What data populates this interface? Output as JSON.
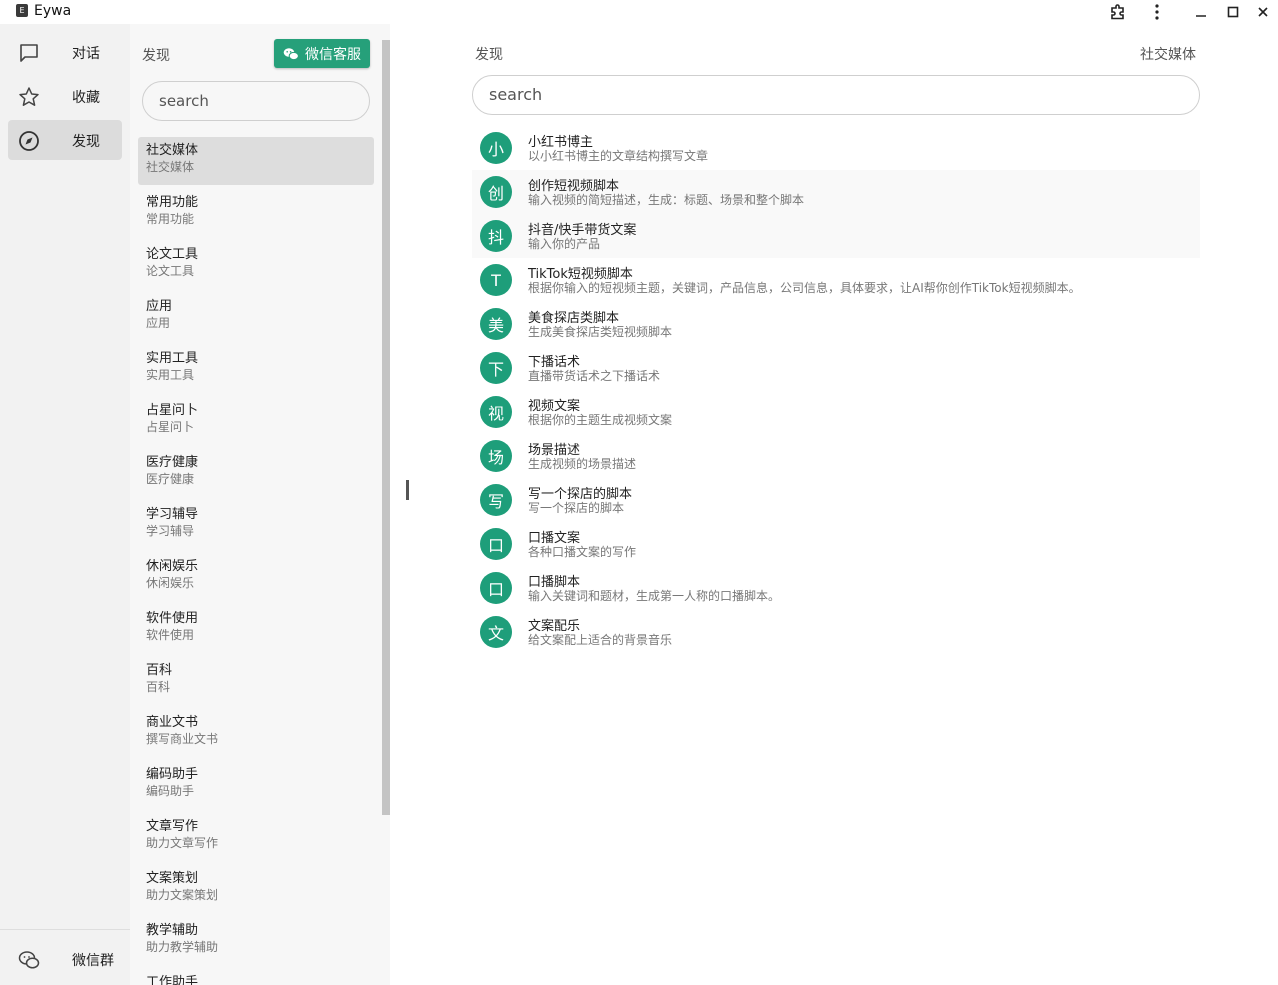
{
  "window": {
    "title": "Eywa",
    "icon_letter": "E"
  },
  "rail": {
    "items": [
      {
        "label": "对话",
        "icon": "chat-icon"
      },
      {
        "label": "收藏",
        "icon": "star-icon"
      },
      {
        "label": "发现",
        "icon": "compass-icon",
        "active": true
      }
    ],
    "bottom": {
      "label": "微信群",
      "icon": "wechat-icon"
    }
  },
  "categories": {
    "title": "发现",
    "wechat_button": "微信客服",
    "search_placeholder": "search",
    "items": [
      {
        "name": "社交媒体",
        "sub": "社交媒体",
        "active": true
      },
      {
        "name": "常用功能",
        "sub": "常用功能"
      },
      {
        "name": "论文工具",
        "sub": "论文工具"
      },
      {
        "name": "应用",
        "sub": "应用"
      },
      {
        "name": "实用工具",
        "sub": "实用工具"
      },
      {
        "name": "占星问卜",
        "sub": "占星问卜"
      },
      {
        "name": "医疗健康",
        "sub": "医疗健康"
      },
      {
        "name": "学习辅导",
        "sub": "学习辅导"
      },
      {
        "name": "休闲娱乐",
        "sub": "休闲娱乐"
      },
      {
        "name": "软件使用",
        "sub": "软件使用"
      },
      {
        "name": "百科",
        "sub": "百科"
      },
      {
        "name": "商业文书",
        "sub": "撰写商业文书"
      },
      {
        "name": "编码助手",
        "sub": "编码助手"
      },
      {
        "name": "文章写作",
        "sub": "助力文章写作"
      },
      {
        "name": "文案策划",
        "sub": "助力文案策划"
      },
      {
        "name": "教学辅助",
        "sub": "助力教学辅助"
      },
      {
        "name": "工作助手",
        "sub": ""
      }
    ]
  },
  "main": {
    "breadcrumb": "发现",
    "current_category": "社交媒体",
    "search_placeholder": "search",
    "accent_color": "#1e9e7a",
    "items": [
      {
        "avatar": "小",
        "title": "小红书博主",
        "desc": "以小红书博主的文章结构撰写文章"
      },
      {
        "avatar": "创",
        "title": "创作短视频脚本",
        "desc": "输入视频的简短描述，生成：标题、场景和整个脚本"
      },
      {
        "avatar": "抖",
        "title": "抖音/快手带货文案",
        "desc": "输入你的产品"
      },
      {
        "avatar": "T",
        "title": "TikTok短视频脚本",
        "desc": "根据你输入的短视频主题，关键词，产品信息，公司信息，具体要求，让AI帮你创作TikTok短视频脚本。"
      },
      {
        "avatar": "美",
        "title": "美食探店类脚本",
        "desc": "生成美食探店类短视频脚本"
      },
      {
        "avatar": "下",
        "title": "下播话术",
        "desc": "直播带货话术之下播话术"
      },
      {
        "avatar": "视",
        "title": "视频文案",
        "desc": "根据你的主题生成视频文案"
      },
      {
        "avatar": "场",
        "title": "场景描述",
        "desc": "生成视频的场景描述"
      },
      {
        "avatar": "写",
        "title": "写一个探店的脚本",
        "desc": "写一个探店的脚本"
      },
      {
        "avatar": "口",
        "title": "口播文案",
        "desc": "各种口播文案的写作"
      },
      {
        "avatar": "口",
        "title": "口播脚本",
        "desc": "输入关键词和题材，生成第一人称的口播脚本。"
      },
      {
        "avatar": "文",
        "title": "文案配乐",
        "desc": "给文案配上适合的背景音乐"
      }
    ]
  }
}
